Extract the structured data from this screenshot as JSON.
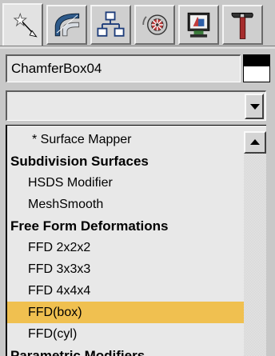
{
  "command_panel": {
    "tabs": [
      {
        "icon": "create-icon",
        "selected": true
      },
      {
        "icon": "modify-icon",
        "selected": false
      },
      {
        "icon": "hierarchy-icon",
        "selected": false
      },
      {
        "icon": "motion-icon",
        "selected": false
      },
      {
        "icon": "display-icon",
        "selected": false
      },
      {
        "icon": "utilities-icon",
        "selected": false
      }
    ],
    "object_name": "ChamferBox04",
    "object_color": "#000000",
    "modifier_list": {
      "value": "",
      "items": [
        {
          "label": "* Surface Mapper",
          "kind": "modifier"
        },
        {
          "label": "Subdivision Surfaces",
          "kind": "category"
        },
        {
          "label": "HSDS Modifier",
          "kind": "modifier"
        },
        {
          "label": "MeshSmooth",
          "kind": "modifier"
        },
        {
          "label": "Free Form Deformations",
          "kind": "category"
        },
        {
          "label": "FFD 2x2x2",
          "kind": "modifier"
        },
        {
          "label": "FFD 3x3x3",
          "kind": "modifier"
        },
        {
          "label": "FFD 4x4x4",
          "kind": "modifier"
        },
        {
          "label": "FFD(box)",
          "kind": "modifier",
          "selected": true
        },
        {
          "label": "FFD(cyl)",
          "kind": "modifier"
        },
        {
          "label": "Parametric Modifiers",
          "kind": "category"
        }
      ]
    },
    "colors": {
      "highlight": "#f0c050",
      "panel": "#c8c8c8"
    }
  }
}
